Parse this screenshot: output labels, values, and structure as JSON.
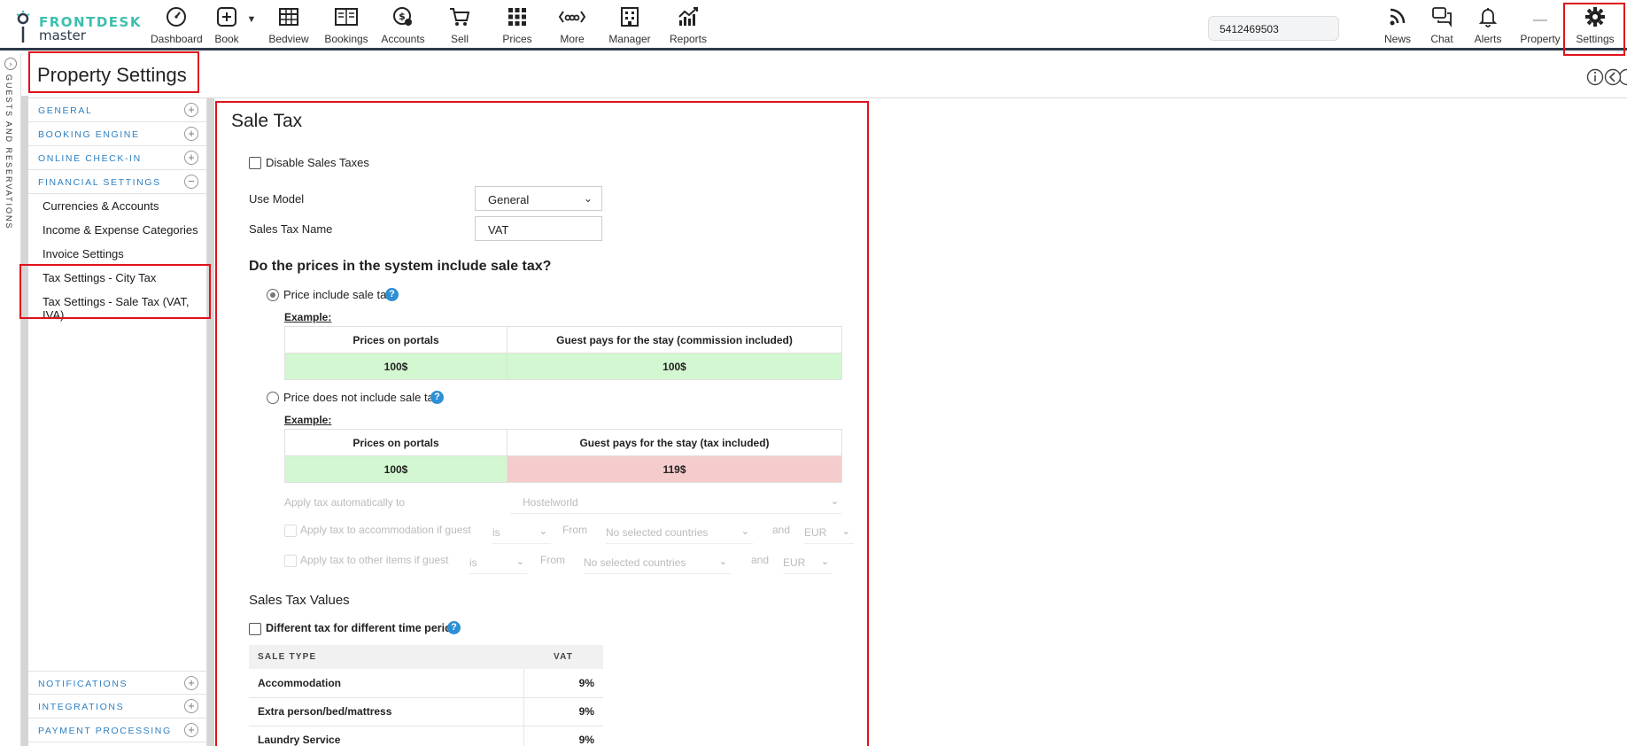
{
  "brand": {
    "word1": "FRONTDESK",
    "word2": "master"
  },
  "nav": {
    "items": [
      {
        "label": "Dashboard",
        "icon": "dashboard-gauge-icon"
      },
      {
        "label": "Book",
        "icon": "plus-square-icon"
      },
      {
        "label": "Bedview",
        "icon": "grid-table-icon"
      },
      {
        "label": "Bookings",
        "icon": "list-book-icon"
      },
      {
        "label": "Accounts",
        "icon": "money-icon"
      },
      {
        "label": "Sell",
        "icon": "cart-icon"
      },
      {
        "label": "Prices",
        "icon": "dots-grid-icon"
      },
      {
        "label": "More",
        "icon": "ellipsis-brackets-icon"
      },
      {
        "label": "Manager",
        "icon": "building-icon"
      },
      {
        "label": "Reports",
        "icon": "chart-icon"
      }
    ],
    "search_value": "5412469503",
    "right_items": [
      {
        "label": "News",
        "icon": "rss-icon"
      },
      {
        "label": "Chat",
        "icon": "chat-icon"
      },
      {
        "label": "Alerts",
        "icon": "bell-icon"
      },
      {
        "label": "Property",
        "icon": "dash-icon"
      },
      {
        "label": "Settings",
        "icon": "gear-icon"
      }
    ]
  },
  "left_strip": {
    "text": "GUESTS AND RESERVATIONS"
  },
  "page": {
    "title": "Property Settings"
  },
  "sidebar": {
    "sections_top": [
      {
        "label": "GENERAL",
        "state": "+"
      },
      {
        "label": "BOOKING ENGINE",
        "state": "+"
      },
      {
        "label": "ONLINE CHECK-IN",
        "state": "+"
      },
      {
        "label": "FINANCIAL SETTINGS",
        "state": "−"
      }
    ],
    "financial_items": [
      "Currencies & Accounts",
      "Income & Expense Categories",
      "Invoice Settings",
      "Tax Settings - City Tax",
      "Tax Settings - Sale Tax (VAT, IVA)"
    ],
    "sections_bottom": [
      {
        "label": "NOTIFICATIONS",
        "state": "+"
      },
      {
        "label": "INTEGRATIONS",
        "state": "+"
      },
      {
        "label": "PAYMENT PROCESSING",
        "state": "+"
      }
    ]
  },
  "content": {
    "title": "Sale Tax",
    "disable_label": "Disable Sales Taxes",
    "use_model_label": "Use Model",
    "use_model_value": "General",
    "tax_name_label": "Sales Tax Name",
    "tax_name_value": "VAT",
    "question": "Do the prices in the system include sale tax?",
    "option1": {
      "label": "Price include sale tax",
      "example": "Example:",
      "col1": "Prices on portals",
      "col2": "Guest pays for the stay (commission included)",
      "val1": "100$",
      "val2": "100$"
    },
    "option2": {
      "label": "Price does not include sale tax",
      "example": "Example:",
      "col1": "Prices on portals",
      "col2": "Guest pays for the stay (tax included)",
      "val1": "100$",
      "val2": "119$"
    },
    "apply_auto": {
      "label": "Apply tax automatically to",
      "value": "Hostelworld"
    },
    "rule1": {
      "label": "Apply tax to accommodation if guest",
      "op": "is",
      "from": "From",
      "countries": "No selected countries",
      "and": "and",
      "currency": "EUR"
    },
    "rule2": {
      "label": "Apply tax to other items if guest",
      "op": "is",
      "from": "From",
      "countries": "No selected countries",
      "and": "and",
      "currency": "EUR"
    },
    "values_title": "Sales Tax Values",
    "diff_label": "Different tax for different time period",
    "table": {
      "col_type": "SALE TYPE",
      "col_vat": "VAT",
      "rows": [
        {
          "type": "Accommodation",
          "vat": "9%"
        },
        {
          "type": "Extra person/bed/mattress",
          "vat": "9%"
        },
        {
          "type": "Laundry Service",
          "vat": "9%"
        }
      ]
    }
  }
}
